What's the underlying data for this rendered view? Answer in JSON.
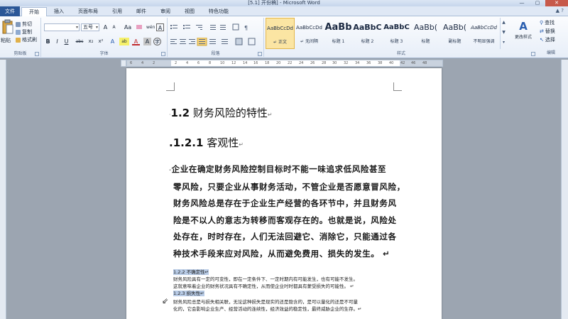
{
  "window": {
    "title": "[5.1] 开份稿] - Microsoft Word",
    "min": "—",
    "max": "▢",
    "close": "✕"
  },
  "tabs": {
    "file": "文件",
    "items": [
      "开始",
      "插入",
      "页面布局",
      "引用",
      "邮件",
      "审阅",
      "视图",
      "特色功能"
    ],
    "right": "▲ ?"
  },
  "ribbon": {
    "clipboard": {
      "paste": "粘贴",
      "cut": "剪切",
      "copy": "复制",
      "format_painter": "格式刷",
      "label": "剪贴板"
    },
    "font": {
      "face": "",
      "size": "五号",
      "label": "字体",
      "grow": "A",
      "shrink": "A",
      "clear": "Aa",
      "wen": "wén",
      "A_border": "A",
      "bold": "B",
      "italic": "I",
      "underline": "U",
      "strike": "abc",
      "sub": "x₂",
      "sup": "x²",
      "effects": "A",
      "highlight": "ab",
      "color": "A",
      "char_shade": "A",
      "enclosed": "字"
    },
    "paragraph": {
      "label": "段落"
    },
    "styles": {
      "label": "样式",
      "items": [
        {
          "sample": "AaBbCcDd",
          "name": "↵ 正文"
        },
        {
          "sample": "AaBbCcDd",
          "name": "↵ 无间隔"
        },
        {
          "sample": "AaBb",
          "name": "标题 1"
        },
        {
          "sample": "AaBbC",
          "name": "标题 2"
        },
        {
          "sample": "AaBbC",
          "name": "标题 3"
        },
        {
          "sample": "AaBb(",
          "name": "标题"
        },
        {
          "sample": "AaBb(",
          "name": "副标题"
        },
        {
          "sample": "AaBbCcDd",
          "name": "不明显强调"
        }
      ],
      "change": "更改样式"
    },
    "editing": {
      "find": "查找",
      "replace": "替换",
      "select": "选择",
      "label": "编辑"
    }
  },
  "ruler": {
    "ticks": [
      "6",
      "4",
      "2",
      "",
      "2",
      "4",
      "6",
      "8",
      "10",
      "12",
      "14",
      "16",
      "18",
      "20",
      "22",
      "24",
      "26",
      "28",
      "30",
      "32",
      "34",
      "36",
      "38",
      "40",
      "42",
      "46",
      "48"
    ]
  },
  "document": {
    "heading2": {
      "number": "1.2",
      "text": "财务风险的特性",
      "mark": "↵"
    },
    "heading3": {
      "number": ".1.2.1",
      "text": "客观性",
      "mark": "↵"
    },
    "paragraph_lines": [
      "企业在确定财务风险控制目标时不能一味追求低风险甚至",
      "零风险，只要企业从事财务活动，不管企业是否愿意冒风险，",
      "财务风险总是存在于企业生产经营的各环节中，并且财务风",
      "险是不以人的意志为转移而客观存在的。也就是说，风险处",
      "处存在，时时存在，人们无法回避它、消除它，只能通过各",
      "种技术手段来应对风险，从而避免费用、损失的发生。  ↵"
    ],
    "small_lines": [
      {
        "text": "1.2.2 不确定性↵",
        "highlight": true
      },
      {
        "text": "财务风险具有一定的可变性，即在一定条件下、一定时期内有可能发生，也有可能不发生。",
        "highlight": false
      },
      {
        "text": "这就意味着企业的财务状况具有不确定性，从而使企业时时都具有蒙受损失的可能性。 ↵",
        "highlight": false
      },
      {
        "text": "1.2.3 损失性↵",
        "highlight": true
      },
      {
        "text": "财务风险总是与损失相关联，无论这种损失是现实的还是隐含的，是可以量化的还是不可量",
        "highlight": false
      },
      {
        "text": "化的，它会影响企业生产、经营活动的连续性，经济效益的稳定性，最终威胁企业的生存。↵",
        "highlight": false
      }
    ]
  },
  "colors": {
    "file_tab": "#2b5797",
    "highlight": "#b8cbe6",
    "active_style": "#fbe5a3"
  }
}
